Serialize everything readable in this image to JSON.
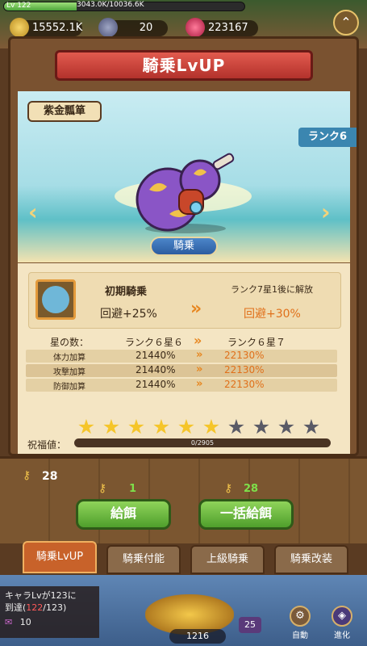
{
  "hud": {
    "level": "Lv 122",
    "exp": "3043.0K/10036.6K",
    "exp_fraction": 0.303,
    "gold": "15552.1K",
    "crystal": "20",
    "gem": "223167"
  },
  "title": "騎乗LvUP",
  "mount": {
    "name": "紫金瓢箪",
    "rank": "ランク6",
    "ride_button": "騎乗"
  },
  "skill": {
    "current_label": "初期騎乗",
    "current_value": "回避+25%",
    "next_label": "ランク7星1後に解放",
    "next_value": "回避+30%"
  },
  "stats": {
    "header_label": "星の数：",
    "header_current": "ランク６星６",
    "header_next": "ランク６星７",
    "rows": [
      {
        "name": "体力加算",
        "current": "21440%",
        "next": "22130%"
      },
      {
        "name": "攻撃加算",
        "current": "21440%",
        "next": "22130%"
      },
      {
        "name": "防御加算",
        "current": "21440%",
        "next": "22130%"
      }
    ]
  },
  "stars": {
    "filled": 6,
    "total": 10
  },
  "blessing": {
    "label": "祝福値：",
    "value": "0/2905",
    "fraction": 0
  },
  "feed": {
    "owned_keys": "28",
    "feed_cost": "1",
    "feed_label": "給餌",
    "bulk_cost": "28",
    "bulk_label": "一括給餌"
  },
  "tabs": [
    "騎乗LvUP",
    "騎乗付能",
    "上級騎乗",
    "騎乗改装"
  ],
  "notice": {
    "line1": "キャラLvが123に",
    "line2_prefix": "到達(",
    "line2_red": "122",
    "line2_suffix": "/123)",
    "ticket_count": "10"
  },
  "bottom": {
    "count": "1216",
    "badge": "25",
    "auto_label": "自動",
    "evolve_label": "進化"
  }
}
